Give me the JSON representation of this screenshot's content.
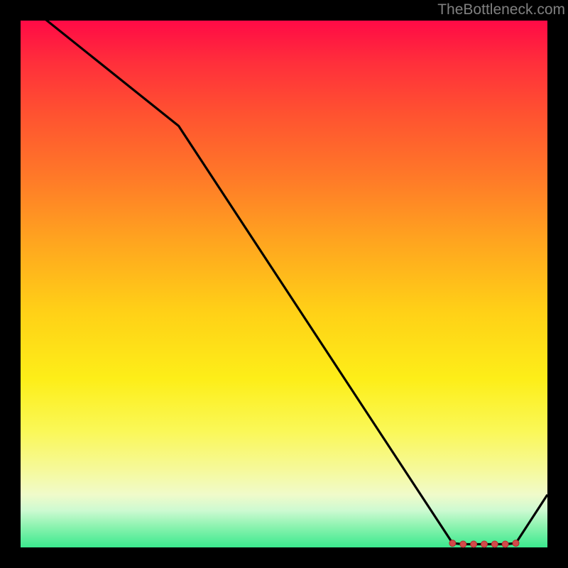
{
  "attribution": "TheBottleneck.com",
  "colors": {
    "frame": "#000000",
    "line": "#000000",
    "marker_fill": "#d24a4a",
    "marker_stroke": "#b22c2c"
  },
  "chart_data": {
    "type": "line",
    "title": "",
    "xlabel": "",
    "ylabel": "",
    "xlim": [
      0,
      100
    ],
    "ylim": [
      0,
      100
    ],
    "x": [
      0,
      30,
      82,
      84,
      86,
      88,
      90,
      92,
      94,
      100
    ],
    "values": [
      104,
      80,
      0.8,
      0.6,
      0.6,
      0.6,
      0.6,
      0.6,
      0.8,
      10
    ],
    "markers_x": [
      82,
      84,
      86,
      88,
      90,
      92,
      94
    ],
    "markers_y": [
      0.8,
      0.6,
      0.6,
      0.6,
      0.6,
      0.6,
      0.8
    ],
    "note": "Axes have no visible ticks or labels in the source image; values are estimated from pixel positions. Gradient background encodes bottleneck severity (red=high, green=low)."
  }
}
